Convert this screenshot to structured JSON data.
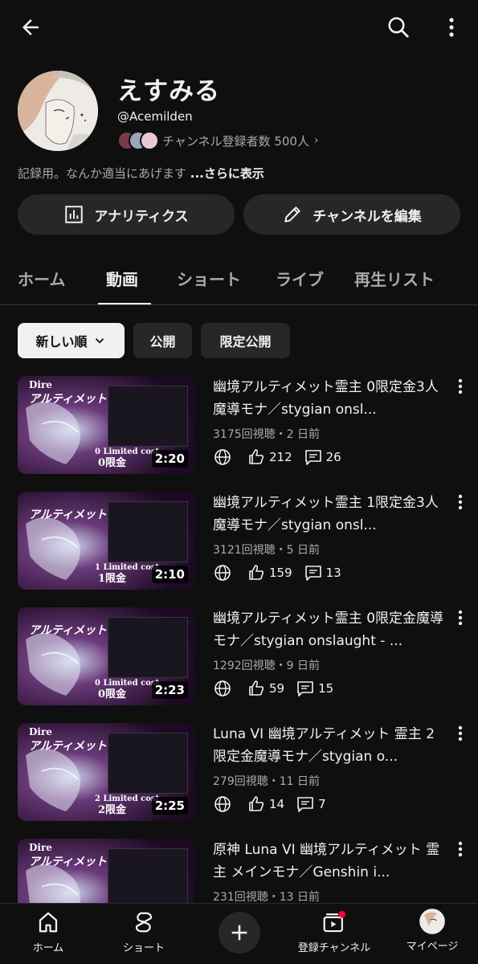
{
  "header": {
    "back_icon": "arrow-left-icon",
    "search_icon": "search-icon",
    "more_icon": "more-vert-icon"
  },
  "channel": {
    "name": "えすみる",
    "handle": "@Acemilden",
    "subscribers": "チャンネル登録者数 500人",
    "description": "記録用。なんか適当にあげます ",
    "more_link": "...さらに表示"
  },
  "actions": {
    "analytics_label": "アナリティクス",
    "edit_label": "チャンネルを編集"
  },
  "tabs": [
    {
      "label": "ホーム"
    },
    {
      "label": "動画"
    },
    {
      "label": "ショート"
    },
    {
      "label": "ライブ"
    },
    {
      "label": "再生リスト"
    }
  ],
  "active_tab": "動画",
  "filters": [
    {
      "label": "新しい順"
    },
    {
      "label": "公開"
    },
    {
      "label": "限定公開"
    }
  ],
  "videos": [
    {
      "title": "幽境アルティメット霊主 0限定金3人 魔導モナ／stygian onsl...",
      "meta": "3175回視聴・2 日前",
      "likes": "212",
      "comments": "26",
      "duration": "2:20",
      "thumb_title": "Dire",
      "thumb_title2": "アルティメット",
      "thumb_sub": "0限金",
      "thumb_sub2": "0 Limited cost"
    },
    {
      "title": "幽境アルティメット霊主 1限定金3人 魔導モナ／stygian onsl...",
      "meta": "3121回視聴・5 日前",
      "likes": "159",
      "comments": "13",
      "duration": "2:10",
      "thumb_title": "",
      "thumb_title2": "アルティメット",
      "thumb_sub": "1限金",
      "thumb_sub2": "1 Limited cost"
    },
    {
      "title": "幽境アルティメット霊主 0限定金魔導モナ／stygian onslaught - ...",
      "meta": "1292回視聴・9 日前",
      "likes": "59",
      "comments": "15",
      "duration": "2:23",
      "thumb_title": "",
      "thumb_title2": "アルティメット",
      "thumb_sub": "0限金",
      "thumb_sub2": "0 Limited cost"
    },
    {
      "title": "Luna VI 幽境アルティメット 霊主 2限定金魔導モナ／stygian o...",
      "meta": "279回視聴・11 日前",
      "likes": "14",
      "comments": "7",
      "duration": "2:25",
      "thumb_title": "Dire",
      "thumb_title2": "アルティメット",
      "thumb_sub": "2限金",
      "thumb_sub2": "2 Limited cost"
    },
    {
      "title": "原神 Luna VI 幽境アルティメット 霊主 メインモナ／Genshin i...",
      "meta": "231回視聴・13 日前",
      "likes": "",
      "comments": "",
      "duration": "",
      "thumb_title": "Dire",
      "thumb_title2": "アルティメット",
      "thumb_sub": "",
      "thumb_sub2": ""
    }
  ],
  "bottom_nav": [
    {
      "label": "ホーム",
      "icon": "home-icon"
    },
    {
      "label": "ショート",
      "icon": "shorts-icon"
    },
    {
      "label": "",
      "icon": "create-plus-icon"
    },
    {
      "label": "登録チャンネル",
      "icon": "subscriptions-icon"
    },
    {
      "label": "マイページ",
      "icon": "avatar-icon"
    }
  ],
  "colors": {
    "background": "#0f0f0f",
    "surface": "#272727",
    "text": "#f1f1f1",
    "secondary_text": "#aaaaaa",
    "notification_dot": "#ff0033"
  }
}
